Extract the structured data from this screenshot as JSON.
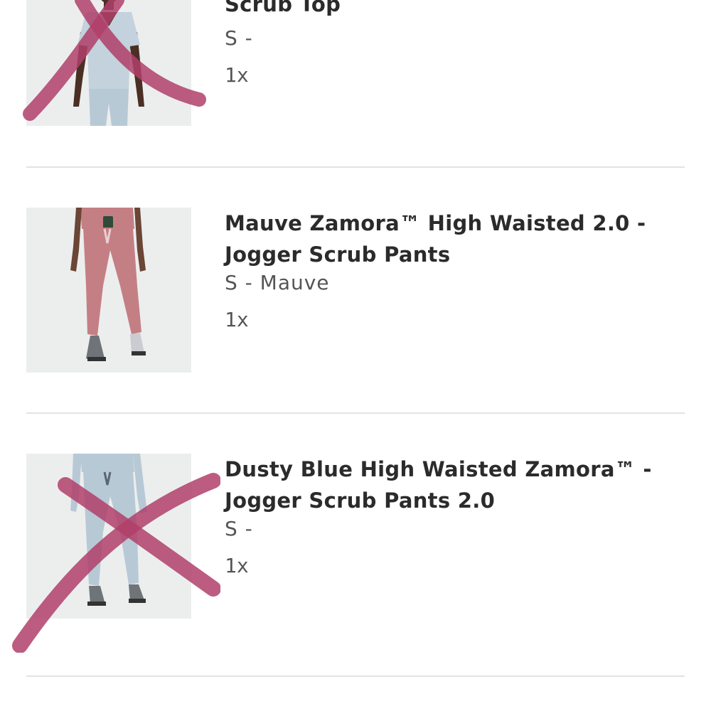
{
  "cart_items": [
    {
      "title_line1": "",
      "title_line2": "Scrub Top",
      "variant": "S -",
      "quantity": "1x",
      "image_icon": "light-blue-scrub-top-photo",
      "crossed_out": true
    },
    {
      "title_line1": "Mauve Zamora™ High Waisted 2.0 -",
      "title_line2": "Jogger Scrub Pants",
      "variant": "S - Mauve",
      "quantity": "1x",
      "image_icon": "mauve-jogger-scrub-pants-photo",
      "crossed_out": false
    },
    {
      "title_line1": "Dusty Blue High Waisted Zamora™ -",
      "title_line2": "Jogger Scrub Pants 2.0",
      "variant": "S -",
      "quantity": "1x",
      "image_icon": "dusty-blue-jogger-scrub-pants-photo",
      "crossed_out": true
    }
  ],
  "colors": {
    "cross_mark": "#b0406a",
    "mauve_fabric": "#c47f85",
    "dusty_blue_fabric": "#b8c9d6",
    "light_blue_fabric": "#c3d2dc"
  }
}
